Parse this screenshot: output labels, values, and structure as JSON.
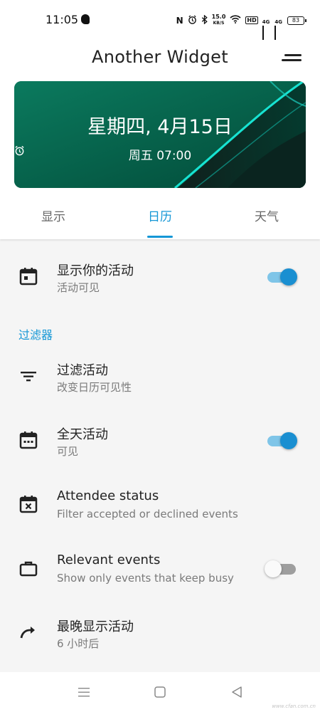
{
  "status_bar": {
    "time": "11:05",
    "net_speed": "15.0",
    "net_speed_unit": "KB/S",
    "hd_badge": "HD",
    "signal_label_1": "4G",
    "signal_label_2": "4G",
    "battery": "83"
  },
  "app_bar": {
    "title": "Another Widget"
  },
  "banner": {
    "date": "星期四, 4月15日",
    "alarm": "周五 07:00",
    "colors": {
      "background": "#05614a",
      "accent": "#17e3d2"
    }
  },
  "tabs": [
    {
      "label": "显示",
      "active": false
    },
    {
      "label": "日历",
      "active": true
    },
    {
      "label": "天气",
      "active": false
    }
  ],
  "settings": {
    "show_events": {
      "title": "显示你的活动",
      "subtitle": "活动可见",
      "toggle": true,
      "icon": "calendar-today-icon"
    },
    "section_filter": "过滤器",
    "filter_events": {
      "title": "过滤活动",
      "subtitle": "改变日历可见性",
      "icon": "filter-icon"
    },
    "all_day_events": {
      "title": "全天活动",
      "subtitle": "可见",
      "toggle": true,
      "icon": "calendar-view-icon"
    },
    "attendee_status": {
      "title": "Attendee status",
      "subtitle": "Filter accepted or declined events",
      "icon": "calendar-x-icon"
    },
    "relevant_events": {
      "title": "Relevant events",
      "subtitle": "Show only events that keep busy",
      "toggle": false,
      "icon": "briefcase-icon"
    },
    "latest_events": {
      "title": "最晚显示活动",
      "subtitle": "6 小时后",
      "icon": "redo-icon"
    }
  },
  "nav_bar": {
    "buttons": [
      "menu-icon",
      "home-square-icon",
      "back-triangle-icon"
    ]
  },
  "watermark": "www.cfan.com.cn",
  "colors": {
    "accent": "#1597d6",
    "toggle_on": "#1a8fd1"
  }
}
